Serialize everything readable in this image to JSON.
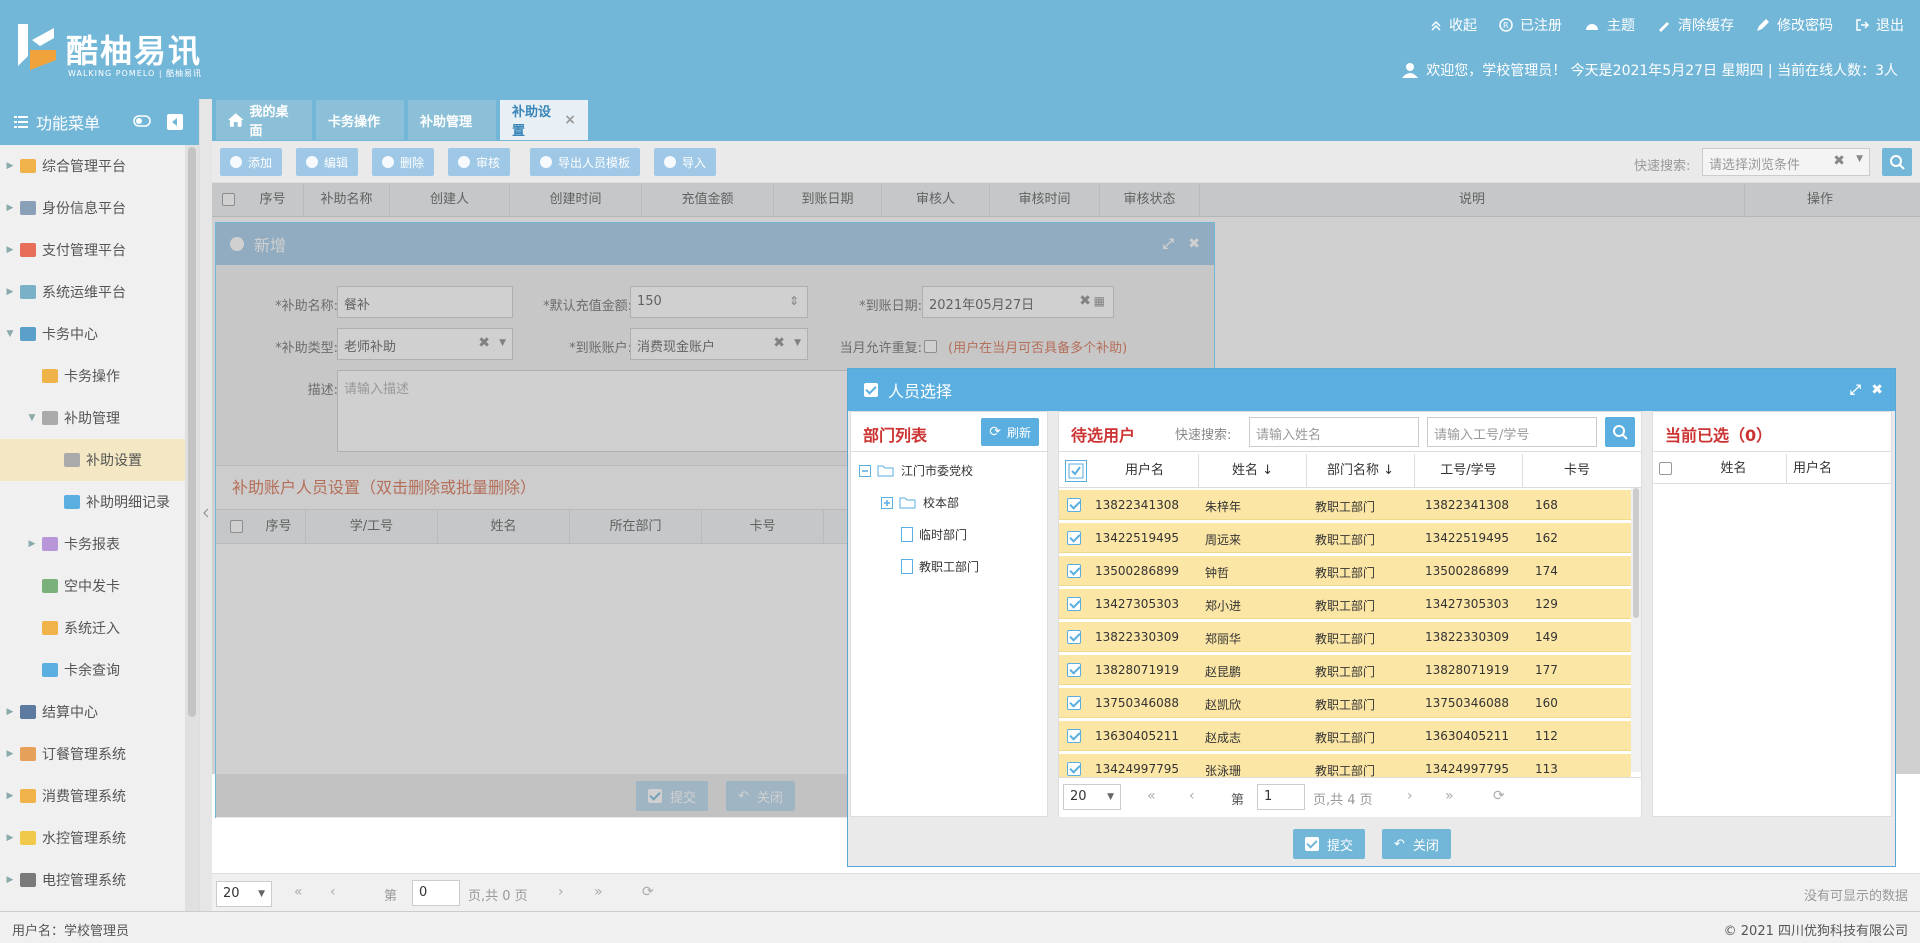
{
  "header": {
    "brand_name": "酷柚易讯",
    "brand_sub": "WALKING POMELO | 酷柚易讯",
    "nav": [
      "收起",
      "已注册",
      "主题",
      "清除缓存",
      "修改密码",
      "退出"
    ],
    "welcome": "欢迎您，学校管理员！ 今天是2021年5月27日 星期四 | 当前在线人数：3人"
  },
  "sidebar": {
    "title": "功能菜单",
    "items": [
      {
        "label": "综合管理平台",
        "level": 0,
        "color": "#f0b34a"
      },
      {
        "label": "身份信息平台",
        "level": 0,
        "color": "#8aa0b8"
      },
      {
        "label": "支付管理平台",
        "level": 0,
        "color": "#e76f5a"
      },
      {
        "label": "系统运维平台",
        "level": 0,
        "color": "#7ab0c8"
      },
      {
        "label": "卡务中心",
        "level": 0,
        "color": "#5aa0c8"
      },
      {
        "label": "卡务操作",
        "level": 1,
        "color": "#f0b34a"
      },
      {
        "label": "补助管理",
        "level": 1,
        "color": "#aaa"
      },
      {
        "label": "补助设置",
        "level": 2,
        "color": "#aaa"
      },
      {
        "label": "补助明细记录",
        "level": 2,
        "color": "#5aaee0"
      },
      {
        "label": "卡务报表",
        "level": 1,
        "color": "#b896d8"
      },
      {
        "label": "空中发卡",
        "level": 1,
        "color": "#7ab07a"
      },
      {
        "label": "系统迁入",
        "level": 1,
        "color": "#f0b34a"
      },
      {
        "label": "卡余查询",
        "level": 1,
        "color": "#5aaee0"
      },
      {
        "label": "结算中心",
        "level": 0,
        "color": "#5a7aa0"
      },
      {
        "label": "订餐管理系统",
        "level": 0,
        "color": "#e7a05a"
      },
      {
        "label": "消费管理系统",
        "level": 0,
        "color": "#f0b34a"
      },
      {
        "label": "水控管理系统",
        "level": 0,
        "color": "#f0c84a"
      },
      {
        "label": "电控管理系统",
        "level": 0,
        "color": "#7a7a7a"
      }
    ]
  },
  "tabs": [
    {
      "label": "我的桌面"
    },
    {
      "label": "卡务操作"
    },
    {
      "label": "补助管理"
    },
    {
      "label": "补助设置",
      "close": "×"
    }
  ],
  "toolbar": {
    "buttons": [
      "添加",
      "编辑",
      "删除",
      "审核",
      "导出人员模板",
      "导入"
    ],
    "quick_search_label": "快速搜索:",
    "quick_search_placeholder": "请选择浏览条件"
  },
  "main_grid": {
    "columns": [
      "序号",
      "补助名称",
      "创建人",
      "创建时间",
      "充值金额",
      "到账日期",
      "审核人",
      "审核时间",
      "审核状态",
      "说明",
      "操作"
    ]
  },
  "main_pager": {
    "page_size": "20",
    "page_prefix": "第",
    "page_value": "0",
    "page_suffix": "页,共 0 页",
    "empty_msg": "没有可显示的数据"
  },
  "footer": {
    "user": "用户名：学校管理员",
    "copyright": "© 2021   四川优狗科技有限公司"
  },
  "dialog_add": {
    "title": "新增",
    "fields": {
      "name_label": "*补助名称:",
      "name_value": "餐补",
      "amount_label": "*默认充值金额:",
      "amount_value": "150",
      "date_label": "*到账日期:",
      "date_value": "2021年05月27日",
      "type_label": "*补助类型:",
      "type_value": "老师补助",
      "account_label": "*到账账户:",
      "account_value": "消费现金账户",
      "repeat_label": "当月允许重复:",
      "repeat_note": "(用户在当月可否具备多个补助)",
      "desc_label": "描述:",
      "desc_placeholder": "请输入描述"
    },
    "section_title": "补助账户人员设置（双击删除或批量删除）",
    "section_columns": [
      "序号",
      "学/工号",
      "姓名",
      "所在部门",
      "卡号"
    ],
    "submit": "提交",
    "close": "关闭"
  },
  "dialog_select": {
    "title": "人员选择",
    "dept": {
      "title": "部门列表",
      "refresh": "刷新",
      "tree": [
        "江门市委党校",
        "校本部",
        "临时部门",
        "教职工部门"
      ]
    },
    "pending": {
      "title": "待选用户",
      "search_label": "快速搜索:",
      "name_placeholder": "请输入姓名",
      "id_placeholder": "请输入工号/学号",
      "columns": [
        "用户名",
        "姓名 ↓",
        "部门名称 ↓",
        "工号/学号",
        "卡号"
      ],
      "rows": [
        [
          "13822341308",
          "朱梓年",
          "教职工部门",
          "13822341308",
          "168"
        ],
        [
          "13422519495",
          "周远来",
          "教职工部门",
          "13422519495",
          "162"
        ],
        [
          "13500286899",
          "钟哲",
          "教职工部门",
          "13500286899",
          "174"
        ],
        [
          "13427305303",
          "郑小进",
          "教职工部门",
          "13427305303",
          "129"
        ],
        [
          "13822330309",
          "郑丽华",
          "教职工部门",
          "13822330309",
          "149"
        ],
        [
          "13828071919",
          "赵昆鹏",
          "教职工部门",
          "13828071919",
          "177"
        ],
        [
          "13750346088",
          "赵凯欣",
          "教职工部门",
          "13750346088",
          "160"
        ],
        [
          "13630405211",
          "赵成志",
          "教职工部门",
          "13630405211",
          "112"
        ],
        [
          "13424997795",
          "张泳珊",
          "教职工部门",
          "13424997795",
          "113"
        ]
      ],
      "page_size": "20",
      "page_prefix": "第",
      "page_value": "1",
      "page_suffix": "页,共 4 页"
    },
    "selected": {
      "title": "当前已选（0）",
      "columns": [
        "姓名",
        "用户名"
      ]
    },
    "submit": "提交",
    "close": "关闭"
  }
}
